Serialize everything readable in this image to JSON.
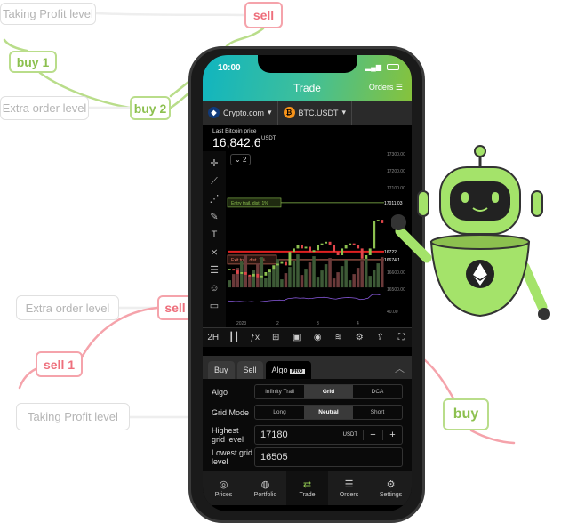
{
  "labels": {
    "taking_profit_top": "Taking Profit level",
    "sell_top": "sell",
    "buy1": "buy 1",
    "extra_order_top": "Extra order level",
    "buy2": "buy 2",
    "extra_order_bottom": "Extra order level",
    "sell_mid": "sell",
    "sell1": "sell 1",
    "taking_profit_bottom": "Taking Profit level",
    "buy_right": "buy"
  },
  "colors": {
    "green": "#8cc04f",
    "pink": "#ee6f7c",
    "robot": "#a4e36a"
  },
  "status": {
    "time": "10:00"
  },
  "header": {
    "title": "Trade",
    "orders": "Orders"
  },
  "exchange": {
    "name": "Crypto.com",
    "pair": "BTC.USDT"
  },
  "price": {
    "label": "Last Bitcoin price",
    "value": "16,842.6",
    "unit": "USDT"
  },
  "chart": {
    "interval_badge": "2",
    "y_ticks": [
      "17300.00",
      "17200.00",
      "17100.00",
      "16600.00",
      "16500.00"
    ],
    "entry_label": "Entry trail. dist.",
    "entry_pct": "1%",
    "entry_price": "17011.03",
    "exit_label": "Exit trail. dist.",
    "exit_pct": "1%",
    "exit_price": "16674.1",
    "red_price": "16722",
    "rsi_tick": "40.00",
    "x_ticks": [
      "2023",
      "2",
      "3",
      "4"
    ],
    "closes": [
      16620,
      16610,
      16590,
      16600,
      16585,
      16575,
      16590,
      16570,
      16580,
      16600,
      16620,
      16640,
      16650,
      16660,
      16640,
      16720,
      16740,
      16760,
      16740,
      16750,
      16720,
      16730,
      16760,
      16770,
      16780,
      16760,
      16720,
      16700,
      16740,
      16760,
      16770,
      16760,
      16740,
      16680,
      16700,
      16740,
      16900,
      16910,
      16890
    ]
  },
  "toolbar": {
    "interval": "2H"
  },
  "panel": {
    "tabs": [
      "Buy",
      "Sell",
      "Algo"
    ],
    "pro": "PRO",
    "algo_label": "Algo",
    "algo_opts": [
      "Infinity Trail",
      "Grid",
      "DCA"
    ],
    "grid_mode_label": "Grid Mode",
    "grid_modes": [
      "Long",
      "Neutral",
      "Short"
    ],
    "highest_label": "Highest grid level",
    "highest_value": "17180",
    "lowest_label": "Lowest grid level",
    "lowest_value": "16505",
    "unit": "USDT"
  },
  "nav": [
    "Prices",
    "Portfolio",
    "Trade",
    "Orders",
    "Settings"
  ]
}
